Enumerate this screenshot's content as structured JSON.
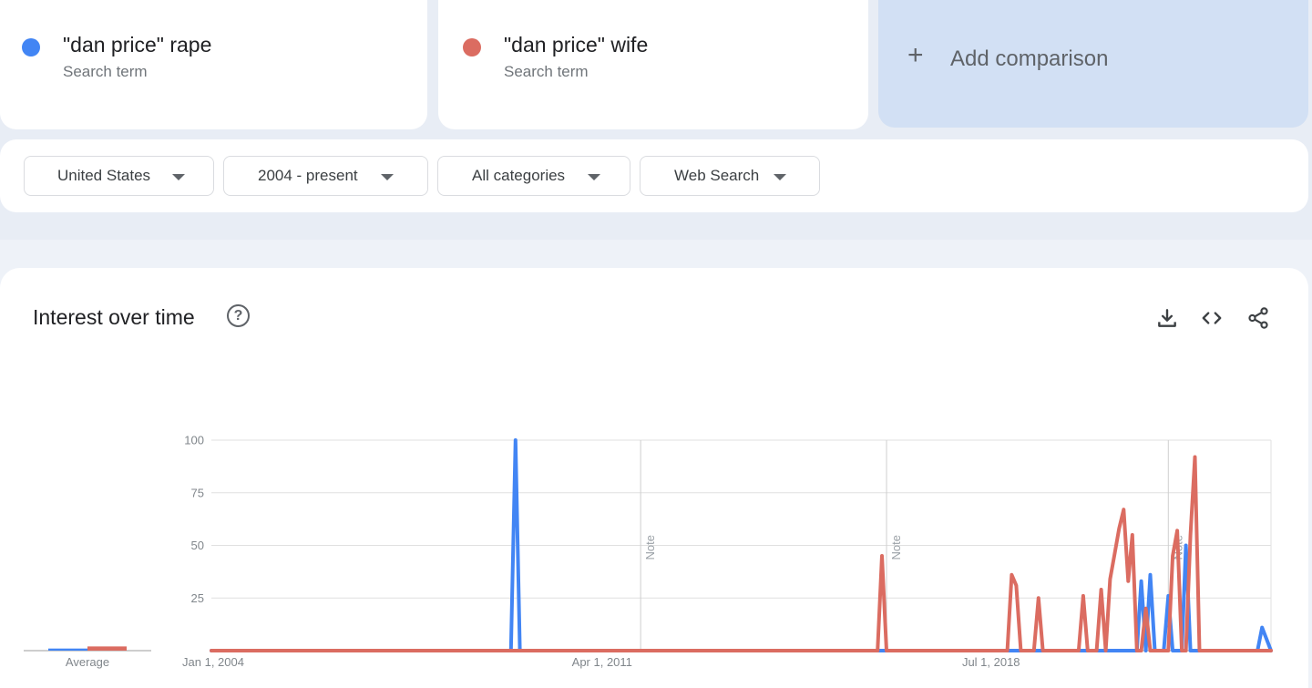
{
  "terms": [
    {
      "label": "\"dan price\" rape",
      "sub": "Search term",
      "color": "#4285f4"
    },
    {
      "label": "\"dan price\" wife",
      "sub": "Search term",
      "color": "#db6c61"
    }
  ],
  "add_comparison": {
    "label": "Add comparison",
    "icon": "plus-icon"
  },
  "filters": {
    "region": "United States",
    "period": "2004 - present",
    "category": "All categories",
    "property": "Web Search"
  },
  "chart": {
    "title": "Interest over time",
    "help_icon": "help-circle-icon",
    "actions": [
      "download-icon",
      "embed-code-icon",
      "share-icon"
    ],
    "average_label": "Average",
    "note_label": "Note"
  },
  "chart_data": {
    "type": "line",
    "x_range": [
      "2004-01-01",
      "2023-10-01"
    ],
    "x_ticks": [
      "Jan 1, 2004",
      "Apr 1, 2011",
      "Jul 1, 2018"
    ],
    "y_ticks": [
      100,
      75,
      50,
      25
    ],
    "ylim": [
      0,
      100
    ],
    "grid": true,
    "notes": [
      "2012-01-01",
      "2016-08-01",
      "2021-11-01"
    ],
    "averages": [
      1,
      2
    ],
    "series": [
      {
        "name": "\"dan price\" rape",
        "color": "#4285f4",
        "points": [
          [
            "2004-01-01",
            0
          ],
          [
            "2009-08-01",
            0
          ],
          [
            "2009-09-01",
            100
          ],
          [
            "2009-10-01",
            0
          ],
          [
            "2021-02-01",
            0
          ],
          [
            "2021-04-01",
            0
          ],
          [
            "2021-05-01",
            33
          ],
          [
            "2021-06-01",
            0
          ],
          [
            "2021-07-01",
            36
          ],
          [
            "2021-08-01",
            0
          ],
          [
            "2021-10-01",
            0
          ],
          [
            "2021-11-01",
            26
          ],
          [
            "2021-12-01",
            0
          ],
          [
            "2022-02-01",
            0
          ],
          [
            "2022-03-01",
            50
          ],
          [
            "2022-04-01",
            0
          ],
          [
            "2023-07-01",
            0
          ],
          [
            "2023-08-01",
            11
          ],
          [
            "2023-10-01",
            0
          ]
        ]
      },
      {
        "name": "\"dan price\" wife",
        "color": "#db6c61",
        "points": [
          [
            "2004-01-01",
            0
          ],
          [
            "2016-06-01",
            0
          ],
          [
            "2016-07-01",
            45
          ],
          [
            "2016-08-01",
            0
          ],
          [
            "2018-11-01",
            0
          ],
          [
            "2018-12-01",
            36
          ],
          [
            "2019-01-01",
            31
          ],
          [
            "2019-02-01",
            0
          ],
          [
            "2019-05-01",
            0
          ],
          [
            "2019-06-01",
            25
          ],
          [
            "2019-07-01",
            0
          ],
          [
            "2020-03-01",
            0
          ],
          [
            "2020-04-01",
            26
          ],
          [
            "2020-05-01",
            0
          ],
          [
            "2020-07-01",
            0
          ],
          [
            "2020-08-01",
            29
          ],
          [
            "2020-09-01",
            0
          ],
          [
            "2020-10-01",
            34
          ],
          [
            "2020-11-01",
            46
          ],
          [
            "2020-12-01",
            58
          ],
          [
            "2021-01-01",
            67
          ],
          [
            "2021-02-01",
            33
          ],
          [
            "2021-03-01",
            55
          ],
          [
            "2021-04-01",
            0
          ],
          [
            "2021-05-01",
            0
          ],
          [
            "2021-06-01",
            20
          ],
          [
            "2021-07-01",
            0
          ],
          [
            "2021-11-01",
            0
          ],
          [
            "2021-12-01",
            45
          ],
          [
            "2022-01-01",
            57
          ],
          [
            "2022-02-01",
            0
          ],
          [
            "2022-03-01",
            0
          ],
          [
            "2022-04-01",
            55
          ],
          [
            "2022-05-01",
            92
          ],
          [
            "2022-06-01",
            0
          ],
          [
            "2023-10-01",
            0
          ]
        ]
      }
    ]
  }
}
